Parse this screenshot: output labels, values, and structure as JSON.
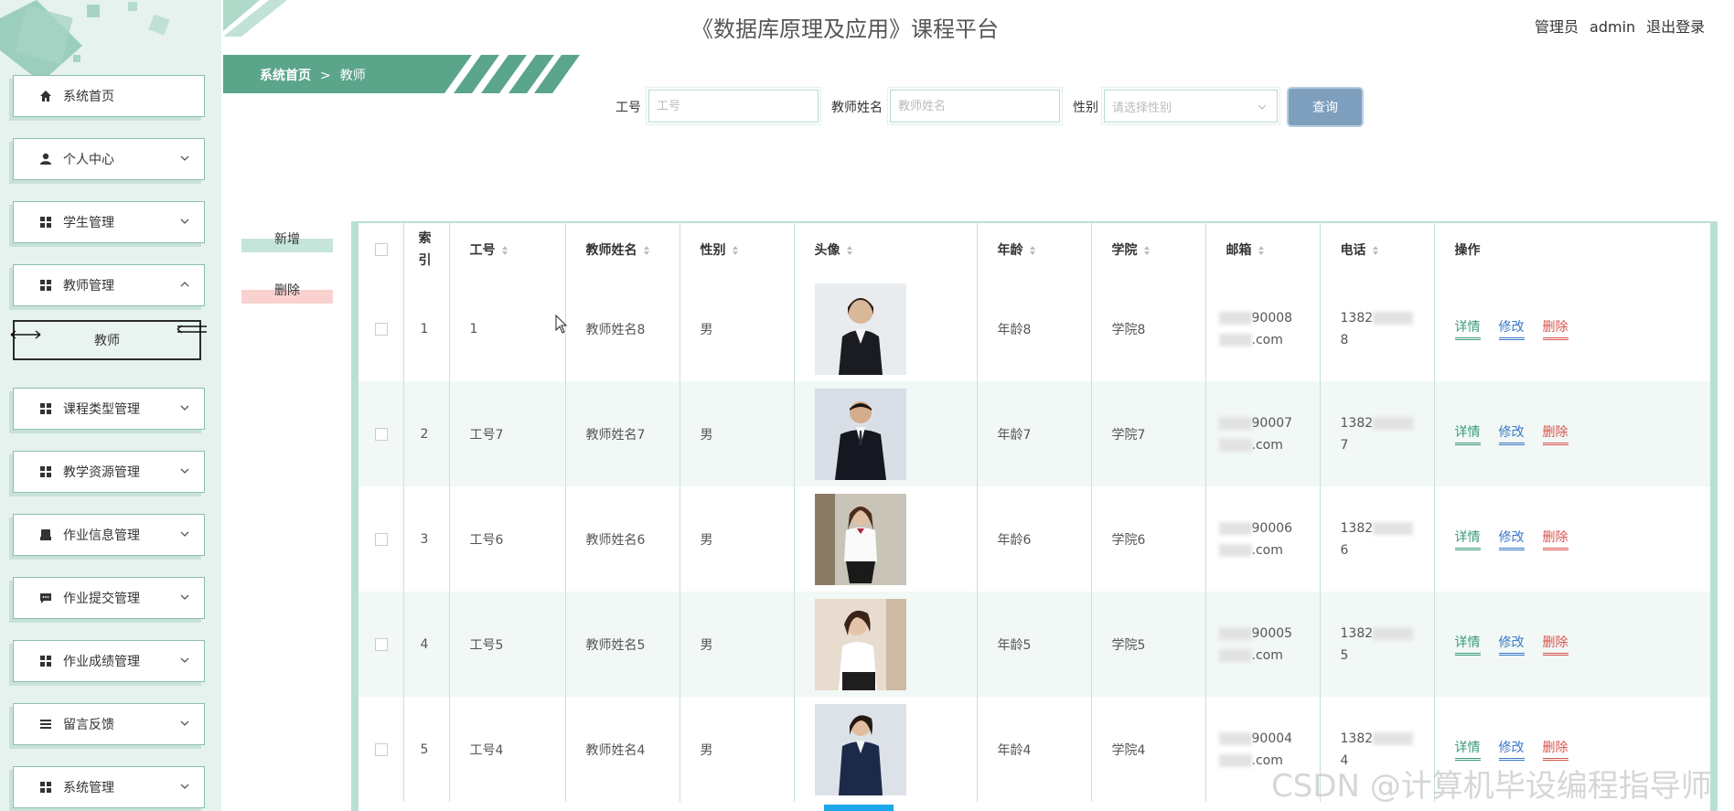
{
  "site": {
    "title": "《数据库原理及应用》课程平台"
  },
  "user": {
    "role": "管理员",
    "name": "admin",
    "logout": "退出登录"
  },
  "breadcrumb": {
    "home": "系统首页",
    "separator": ">",
    "current": "教师"
  },
  "sidebar": {
    "items": [
      {
        "label": "系统首页",
        "icon": "home-icon"
      },
      {
        "label": "个人中心",
        "icon": "user-icon"
      },
      {
        "label": "学生管理",
        "icon": "grid-icon"
      },
      {
        "label": "教师管理",
        "icon": "grid-icon"
      },
      {
        "label": "课程类型管理",
        "icon": "grid-icon"
      },
      {
        "label": "教学资源管理",
        "icon": "grid-icon"
      },
      {
        "label": "作业信息管理",
        "icon": "inbox-icon"
      },
      {
        "label": "作业提交管理",
        "icon": "chat-icon"
      },
      {
        "label": "作业成绩管理",
        "icon": "grid-icon"
      },
      {
        "label": "留言反馈",
        "icon": "list-icon"
      },
      {
        "label": "系统管理",
        "icon": "grid-icon"
      }
    ],
    "submenu": {
      "label": "教师"
    }
  },
  "search": {
    "id_label": "工号",
    "id_placeholder": "工号",
    "name_label": "教师姓名",
    "name_placeholder": "教师姓名",
    "gender_label": "性别",
    "gender_placeholder": "请选择性别",
    "query": "查询"
  },
  "actions": {
    "add": "新增",
    "delete": "删除"
  },
  "table": {
    "headers": {
      "index": "索引",
      "id": "工号",
      "name": "教师姓名",
      "gender": "性别",
      "avatar": "头像",
      "age": "年龄",
      "college": "学院",
      "email": "邮箱",
      "phone": "电话",
      "ops": "操作"
    },
    "ops": {
      "detail": "详情",
      "edit": "修改",
      "delete": "删除"
    },
    "rows": [
      {
        "index": "1",
        "id": "1",
        "name": "教师姓名8",
        "gender": "男",
        "age": "年龄8",
        "college": "学院8",
        "email1": "90008",
        "email2": ".com",
        "phone1": "1382",
        "phone2": "8"
      },
      {
        "index": "2",
        "id": "工号7",
        "name": "教师姓名7",
        "gender": "男",
        "age": "年龄7",
        "college": "学院7",
        "email1": "90007",
        "email2": ".com",
        "phone1": "1382",
        "phone2": "7"
      },
      {
        "index": "3",
        "id": "工号6",
        "name": "教师姓名6",
        "gender": "男",
        "age": "年龄6",
        "college": "学院6",
        "email1": "90006",
        "email2": ".com",
        "phone1": "1382",
        "phone2": "6"
      },
      {
        "index": "4",
        "id": "工号5",
        "name": "教师姓名5",
        "gender": "男",
        "age": "年龄5",
        "college": "学院5",
        "email1": "90005",
        "email2": ".com",
        "phone1": "1382",
        "phone2": "5"
      },
      {
        "index": "5",
        "id": "工号4",
        "name": "教师姓名4",
        "gender": "男",
        "age": "年龄4",
        "college": "学院4",
        "email1": "90004",
        "email2": ".com",
        "phone1": "1382",
        "phone2": "4"
      }
    ]
  },
  "watermark": "CSDN @计算机毕设编程指导师",
  "colors": {
    "accent": "#5ba58a",
    "sidebar_bg": "#e6f2ed",
    "query_button": "#7f9fbf",
    "delete_red": "#d9534f"
  }
}
